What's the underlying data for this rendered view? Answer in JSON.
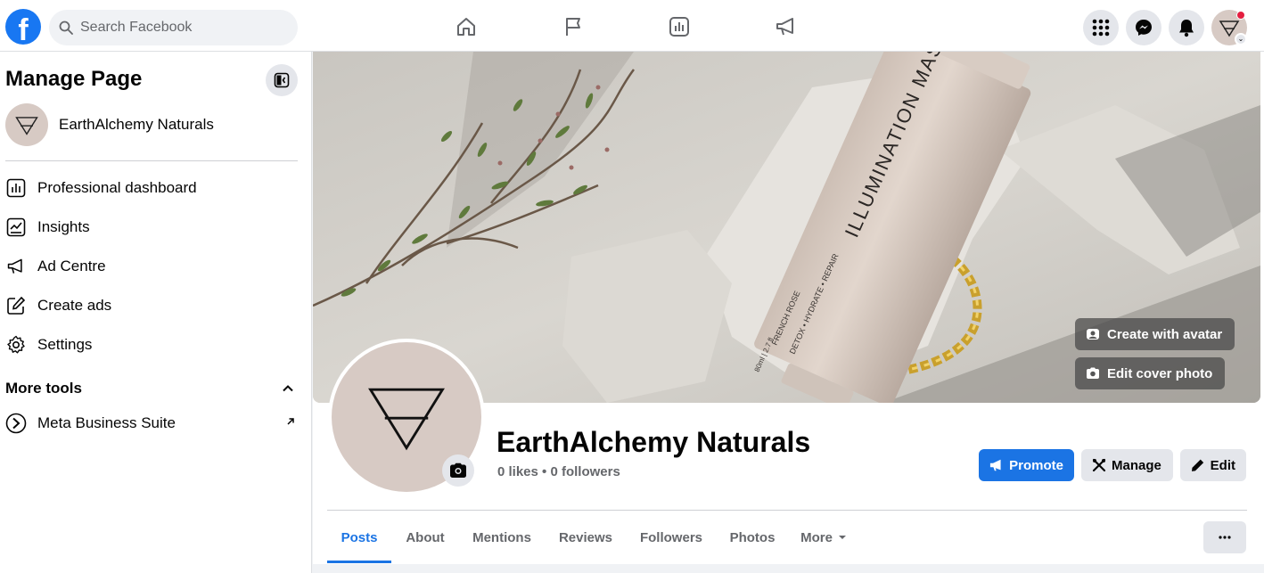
{
  "topbar": {
    "logo": "f",
    "search_placeholder": "Search Facebook",
    "nav_icons": [
      "home-icon",
      "flag-icon",
      "dashboard-icon",
      "megaphone-icon"
    ],
    "right_icons": [
      "menu-grid-icon",
      "messenger-icon",
      "bell-icon",
      "account-avatar"
    ]
  },
  "sidebar": {
    "title": "Manage Page",
    "page_name": "EarthAlchemy Naturals",
    "items": [
      {
        "label": "Professional dashboard",
        "icon": "dashboard-icon"
      },
      {
        "label": "Insights",
        "icon": "insights-icon"
      },
      {
        "label": "Ad Centre",
        "icon": "megaphone-icon"
      },
      {
        "label": "Create ads",
        "icon": "pencil-square-icon"
      },
      {
        "label": "Settings",
        "icon": "gear-icon"
      }
    ],
    "more_tools": "More tools",
    "tools": [
      {
        "label": "Meta Business Suite",
        "icon": "meta-business-icon"
      }
    ]
  },
  "cover": {
    "product_text": "ILLUMINATION MASK",
    "product_subtext": "FRENCH ROSE",
    "product_subtext2": "DETOX • HYDRATE • REPAIR",
    "product_size": "80ml | 2.7 fl",
    "create_avatar": "Create with avatar",
    "edit_cover": "Edit cover photo"
  },
  "profile": {
    "name": "EarthAlchemy Naturals",
    "stats": "0 likes • 0 followers",
    "promote": "Promote",
    "manage": "Manage",
    "edit": "Edit"
  },
  "tabs": [
    "Posts",
    "About",
    "Mentions",
    "Reviews",
    "Followers",
    "Photos",
    "More"
  ],
  "colors": {
    "brand": "#1877f2",
    "accent": "#1b74e4",
    "avatar_bg": "#d7cac4"
  }
}
